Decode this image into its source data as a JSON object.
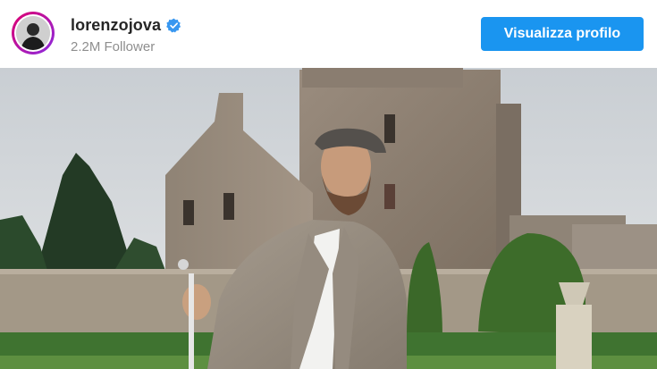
{
  "post_header": {
    "username": "lorenzojova",
    "followers": "2.2M Follower",
    "profile_button_label": "Visualizza profilo",
    "verified": true,
    "accent_color": "#1a95f0"
  },
  "avatar": {
    "icon": "profile-avatar"
  },
  "photo": {
    "icon": "post-photo"
  }
}
